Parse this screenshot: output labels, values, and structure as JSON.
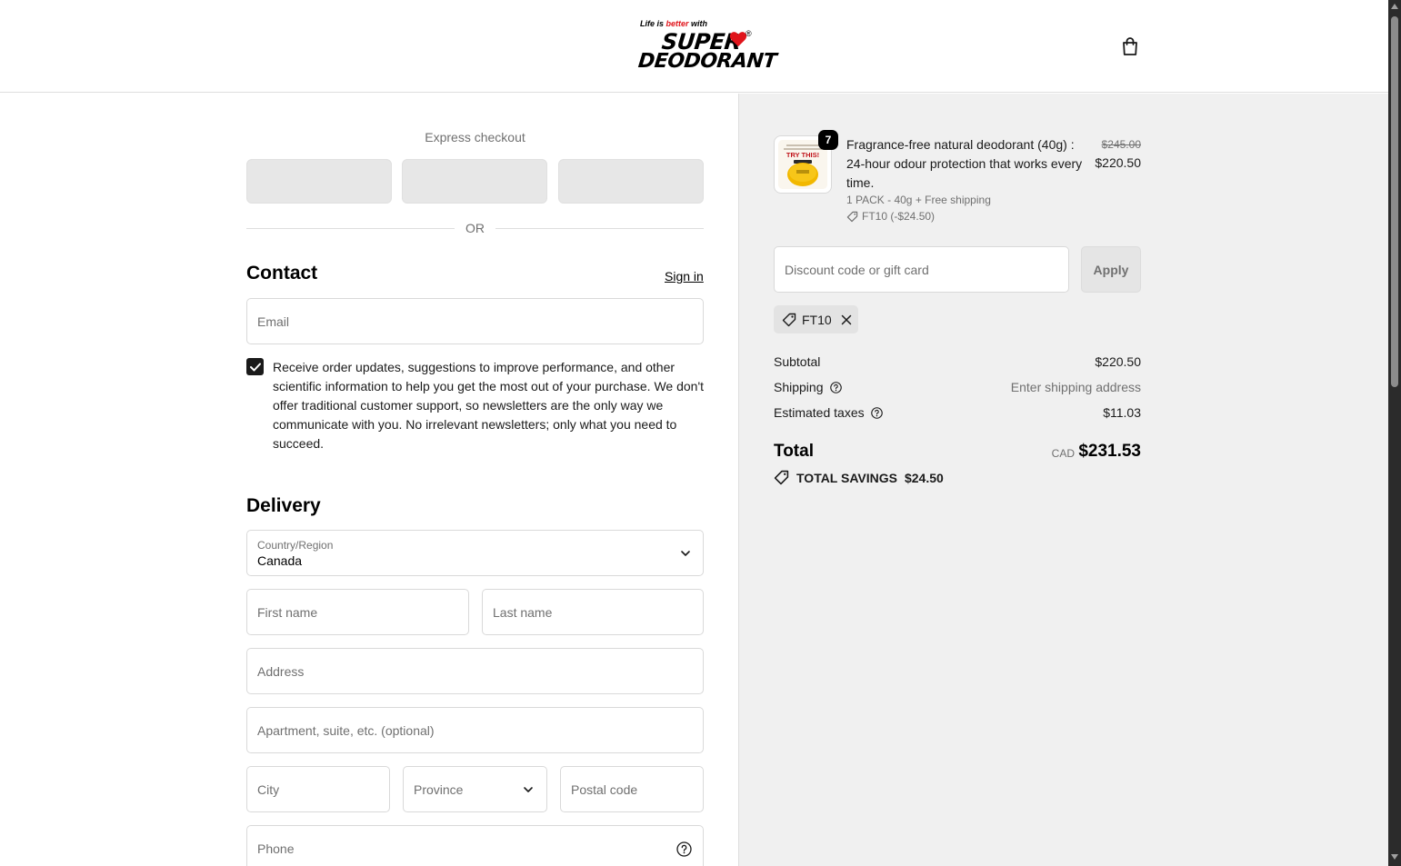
{
  "header": {
    "logo_tagline_pre": "Life is ",
    "logo_tagline_red": "better",
    "logo_tagline_post": " with",
    "logo_line1": "SUPER",
    "logo_line2": "DEODORANT",
    "logo_reg": "®",
    "cart_icon": "shopping-bag-icon"
  },
  "express": {
    "title": "Express checkout",
    "or": "OR"
  },
  "contact": {
    "heading": "Contact",
    "signin": "Sign in",
    "email_placeholder": "Email",
    "consent_checked": true,
    "consent_text": "Receive order updates, suggestions to improve performance, and other scientific information to help you get the most out of your purchase. We don't offer traditional customer support, so newsletters are the only way we communicate with you. No irrelevant newsletters; only what you need to succeed."
  },
  "delivery": {
    "heading": "Delivery",
    "country_label": "Country/Region",
    "country_value": "Canada",
    "first_name_placeholder": "First name",
    "last_name_placeholder": "Last name",
    "address_placeholder": "Address",
    "apartment_placeholder": "Apartment, suite, etc. (optional)",
    "city_placeholder": "City",
    "province_placeholder": "Province",
    "postal_placeholder": "Postal code",
    "phone_placeholder": "Phone"
  },
  "order": {
    "product": {
      "quantity": "7",
      "name": "Fragrance-free natural deodorant (40g) : 24-hour odour protection that works every time.",
      "variant": "1 PACK - 40g + Free shipping",
      "discount": "FT10 (-$24.50)",
      "price_original": "$245.00",
      "price_final": "$220.50",
      "image_text": "TRY THIS!"
    },
    "discount_placeholder": "Discount code or gift card",
    "apply_label": "Apply",
    "applied_code": "FT10",
    "summary": {
      "subtotal_label": "Subtotal",
      "subtotal_value": "$220.50",
      "shipping_label": "Shipping",
      "shipping_value": "Enter shipping address",
      "taxes_label": "Estimated taxes",
      "taxes_value": "$11.03",
      "total_label": "Total",
      "total_currency": "CAD",
      "total_value": "$231.53",
      "savings_label": "TOTAL SAVINGS",
      "savings_value": "$24.50"
    }
  },
  "colors": {
    "accent": "#1a1a1a",
    "panel_bg": "#f0f0f0",
    "logo_red": "#e0141b"
  }
}
